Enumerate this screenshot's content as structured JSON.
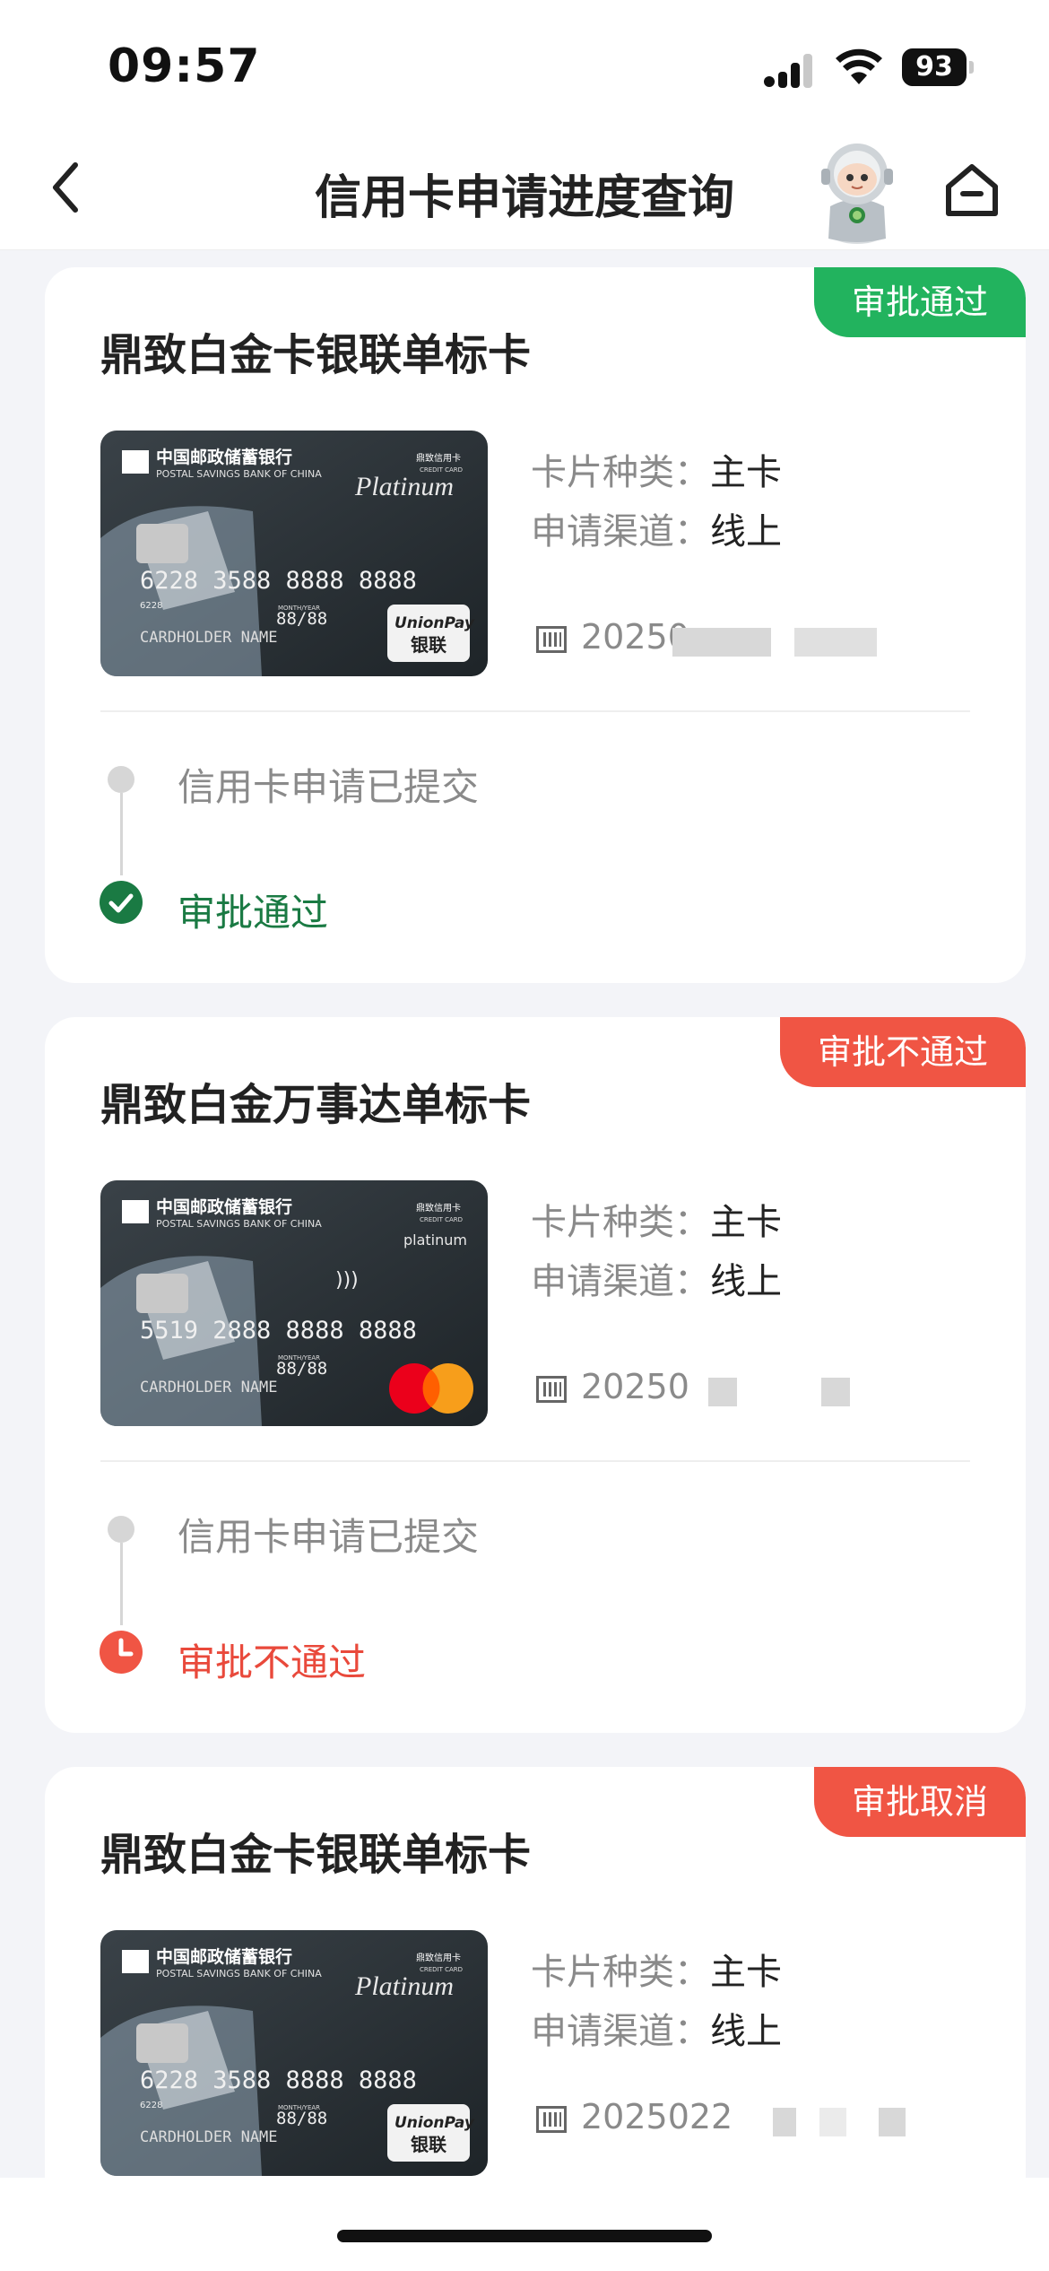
{
  "status_bar": {
    "time": "09:57",
    "battery": "93"
  },
  "nav": {
    "title": "信用卡申请进度查询"
  },
  "labels": {
    "card_type": "卡片种类：",
    "channel": "申请渠道："
  },
  "cards": [
    {
      "badge": "审批通过",
      "title": "鼎致白金卡银联单标卡",
      "card_type": "主卡",
      "channel": "线上",
      "app_no": "20250",
      "step1": "信用卡申请已提交",
      "step2": "审批通过",
      "network": "UnionPay",
      "card_number": "6228 3588 8888 8888",
      "expiry": "88/88"
    },
    {
      "badge": "审批不通过",
      "title": "鼎致白金万事达单标卡",
      "card_type": "主卡",
      "channel": "线上",
      "app_no": "20250",
      "step1": "信用卡申请已提交",
      "step2": "审批不通过",
      "network": "Mastercard",
      "card_number": "5519 2888 8888 8888",
      "expiry": "88/88"
    },
    {
      "badge": "审批取消",
      "title": "鼎致白金卡银联单标卡",
      "card_type": "主卡",
      "channel": "线上",
      "app_no": "2025022",
      "network": "UnionPay",
      "card_number": "6228 3588 8888 8888",
      "expiry": "88/88"
    }
  ],
  "card_face": {
    "bank_cn": "中国邮政储蓄银行",
    "bank_en": "POSTAL SAVINGS BANK OF CHINA",
    "product_cn": "鼎致信用卡",
    "product_en": "CREDIT CARD",
    "tier_script": "Platinum",
    "tier_plain": "platinum",
    "holder": "CARDHOLDER NAME",
    "month_year": "MONTH/YEAR",
    "bin_small": "6228",
    "unionpay_en": "UnionPay",
    "unionpay_cn": "银联"
  },
  "colors": {
    "brand_green": "#22b35e",
    "reject_red": "#f05544",
    "pending_green": "#1a7a43"
  }
}
